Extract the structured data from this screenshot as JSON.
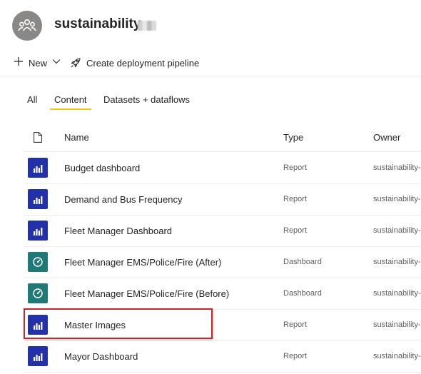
{
  "workspace": {
    "title": "sustainability-",
    "avatar_icon": "people-group-icon"
  },
  "toolbar": {
    "new_label": "New",
    "create_pipeline_label": "Create deployment pipeline"
  },
  "tabs": [
    {
      "label": "All",
      "selected": false
    },
    {
      "label": "Content",
      "selected": true
    },
    {
      "label": "Datasets + dataflows",
      "selected": false
    }
  ],
  "columns": {
    "name": "Name",
    "type": "Type",
    "owner": "Owner"
  },
  "rows": [
    {
      "name": "Budget dashboard",
      "type": "Report",
      "owner": "sustainability-",
      "icon": "report-bar-chart-icon"
    },
    {
      "name": "Demand and Bus Frequency",
      "type": "Report",
      "owner": "sustainability-",
      "icon": "report-bar-chart-icon"
    },
    {
      "name": "Fleet Manager Dashboard",
      "type": "Report",
      "owner": "sustainability-",
      "icon": "report-bar-chart-icon"
    },
    {
      "name": "Fleet Manager EMS/Police/Fire (After)",
      "type": "Dashboard",
      "owner": "sustainability-",
      "icon": "dashboard-gauge-icon"
    },
    {
      "name": "Fleet Manager EMS/Police/Fire (Before)",
      "type": "Dashboard",
      "owner": "sustainability-",
      "icon": "dashboard-gauge-icon"
    },
    {
      "name": "Master Images",
      "type": "Report",
      "owner": "sustainability-",
      "icon": "report-bar-chart-icon"
    },
    {
      "name": "Mayor Dashboard",
      "type": "Report",
      "owner": "sustainability-",
      "icon": "report-bar-chart-icon"
    }
  ],
  "colors": {
    "report_icon_bg": "#2331a8",
    "dashboard_icon_bg": "#1f7a77",
    "tab_underline": "#f2c811",
    "highlight": "#c1272d"
  }
}
